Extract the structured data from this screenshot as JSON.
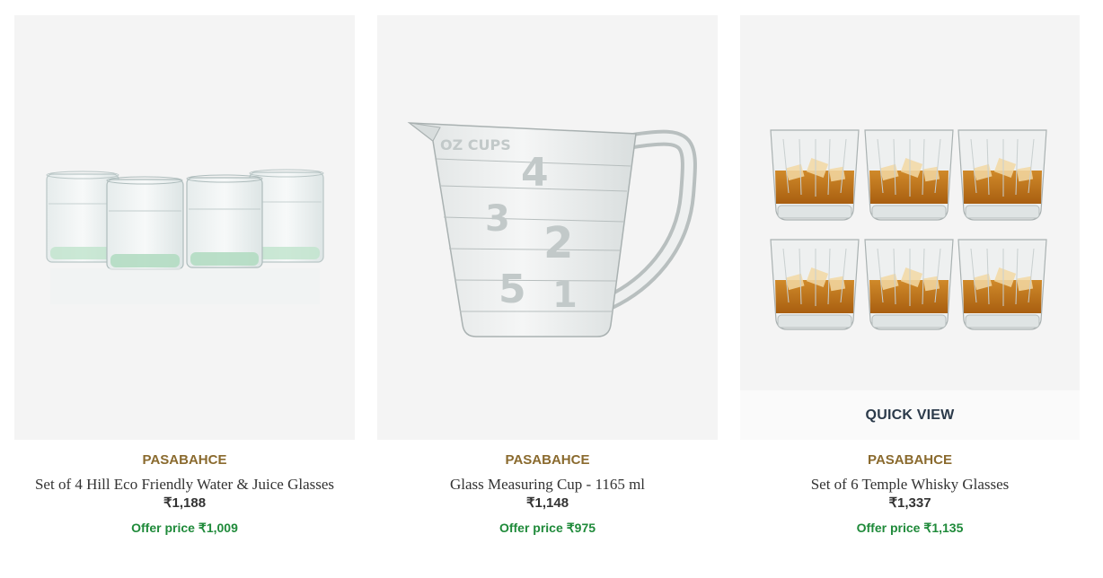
{
  "products": [
    {
      "brand": "PASABAHCE",
      "title": "Set of 4 Hill Eco Friendly Water & Juice Glasses",
      "price": "₹1,188",
      "offer_label": "Offer price",
      "offer_price": "₹1,009",
      "image_alt": "glasses-set-icon"
    },
    {
      "brand": "PASABAHCE",
      "title": "Glass Measuring Cup - 1165 ml",
      "price": "₹1,148",
      "offer_label": "Offer price",
      "offer_price": "₹975",
      "image_alt": "measuring-cup-icon"
    },
    {
      "brand": "PASABAHCE",
      "title": "Set of 6 Temple Whisky Glasses",
      "price": "₹1,337",
      "offer_label": "Offer price",
      "offer_price": "₹1,135",
      "image_alt": "whisky-glasses-icon",
      "quick_view_label": "QUICK VIEW"
    }
  ],
  "colors": {
    "brand": "#8a6a2e",
    "offer": "#1f8a3a",
    "text": "#333333",
    "quick_view": "#2b3a4a",
    "image_bg": "#f4f4f4"
  }
}
